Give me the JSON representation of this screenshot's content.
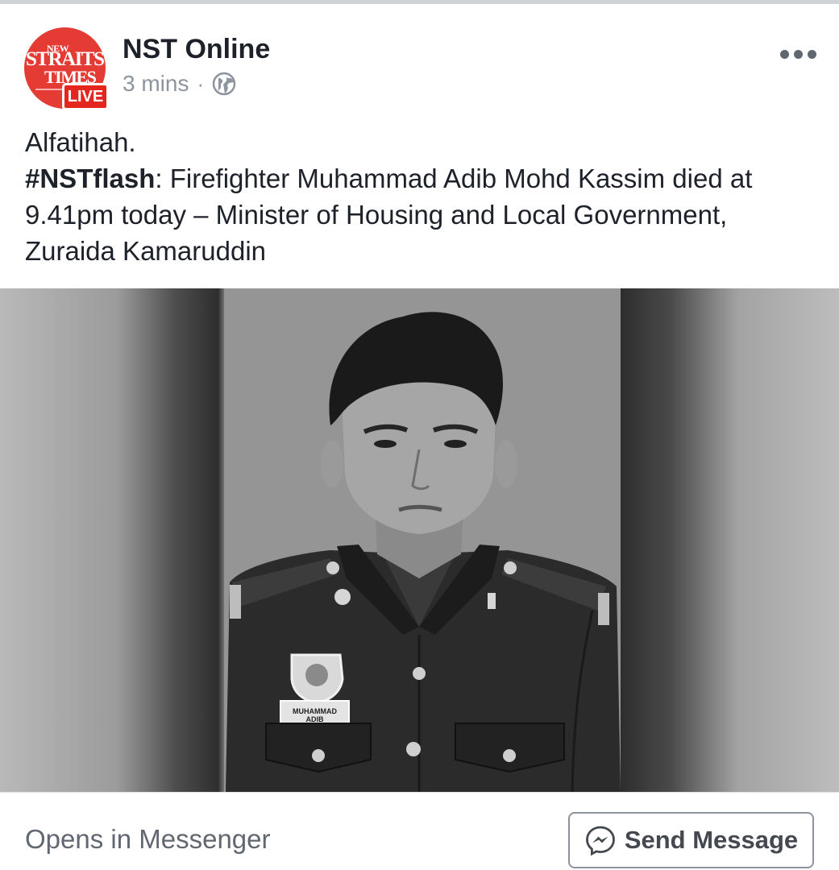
{
  "post": {
    "page_name": "NST Online",
    "timestamp": "3 mins",
    "separator": "·",
    "privacy_icon": "globe-icon",
    "more_icon": "more-options-icon",
    "avatar": {
      "logo_line1": "NEW",
      "logo_line2": "STRAITS",
      "logo_line3": "TIMES",
      "badge": "LIVE"
    },
    "text": {
      "line1": "Alfatihah.",
      "hashtag": "#NSTflash",
      "body": ": Firefighter Muhammad Adib Mohd Kassim died at 9.41pm today – Minister of Housing and Local Government, Zuraida Kamaruddin"
    },
    "photo": {
      "name_tag": "MUHAMMAD ADIB"
    }
  },
  "footer": {
    "caption": "Opens in Messenger",
    "button_label": "Send Message",
    "button_icon": "messenger-icon"
  },
  "colors": {
    "brand_red": "#e53b35",
    "text_primary": "#1d2129",
    "text_secondary": "#8d949e"
  }
}
